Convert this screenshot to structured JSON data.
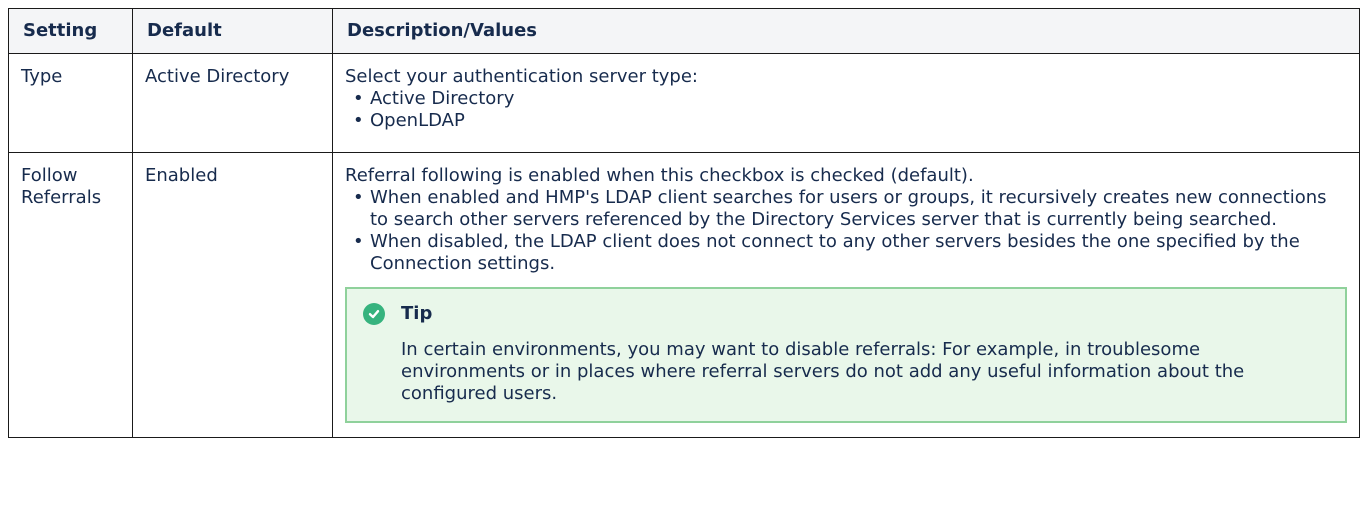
{
  "table": {
    "headers": {
      "setting": "Setting",
      "default": "Default",
      "description": "Description/Values"
    },
    "rows": [
      {
        "setting": "Type",
        "default": "Active Directory",
        "description": "Select your authentication server type:",
        "bullets": [
          "Active Directory",
          "OpenLDAP"
        ]
      },
      {
        "setting": "Follow Referrals",
        "default": "Enabled",
        "description": "Referral following is enabled when this checkbox is checked (default).",
        "bullets": [
          "When enabled and HMP's LDAP client searches for users or groups, it recursively creates new connections to search other servers referenced by the Directory Services server that is currently being searched.",
          "When disabled, the LDAP client does not connect to any other servers besides the one specified by the Connection settings."
        ],
        "tip": {
          "icon": "check-circle-icon",
          "title": "Tip",
          "text": "In certain environments, you may want to disable referrals: For example, in troublesome environments or in places where referral servers do not add any useful information about the configured users."
        }
      }
    ]
  },
  "colors": {
    "border": "#1a1a1a",
    "header_bg": "#f4f5f7",
    "tip_bg": "#e9f7ea",
    "tip_border": "#8fd19b",
    "tip_icon": "#36b37e"
  }
}
